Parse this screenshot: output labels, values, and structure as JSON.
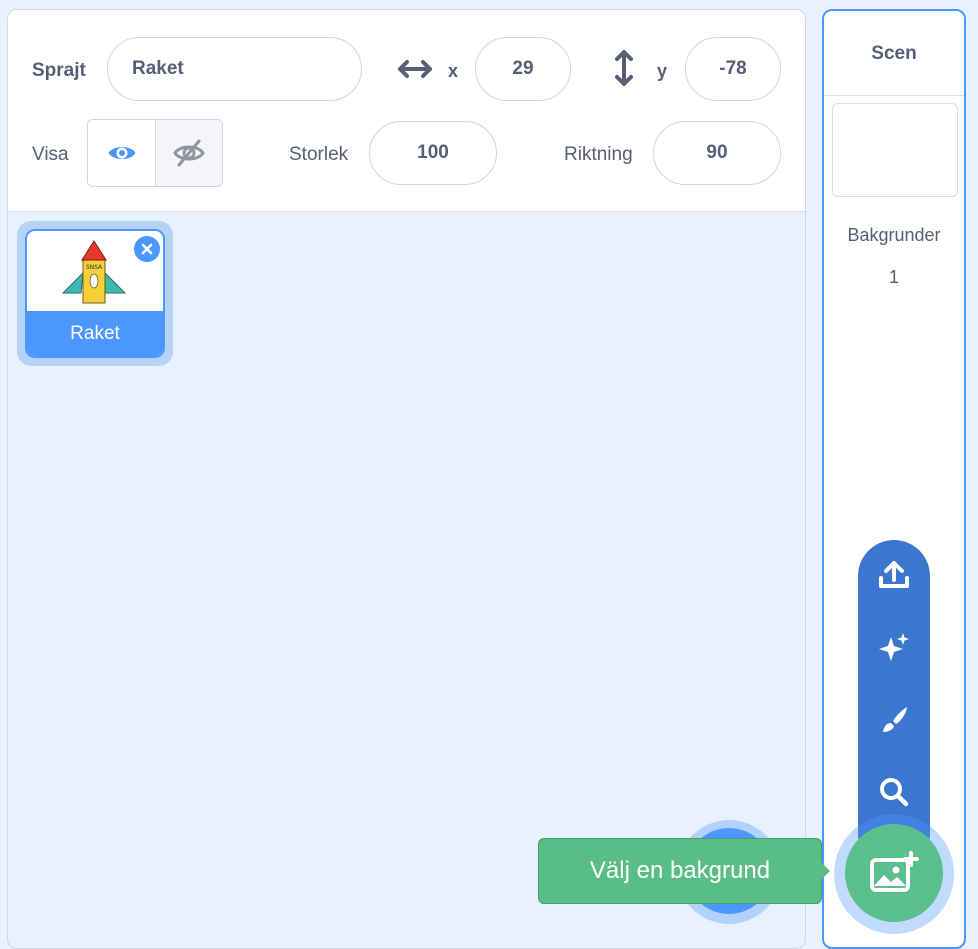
{
  "sprite_info": {
    "sprite_label": "Sprajt",
    "sprite_name": "Raket",
    "x_label": "x",
    "x_value": "29",
    "y_label": "y",
    "y_value": "-78",
    "show_label": "Visa",
    "size_label": "Storlek",
    "size_value": "100",
    "direction_label": "Riktning",
    "direction_value": "90"
  },
  "sprites": [
    {
      "name": "Raket",
      "costume_text": "SNSA"
    }
  ],
  "stage": {
    "title": "Scen",
    "backdrops_label": "Bakgrunder",
    "backdrops_count": "1"
  },
  "tooltip": {
    "text": "Välj en bakgrund"
  },
  "colors": {
    "accent": "#4c97ff",
    "menu": "#3d76cf",
    "green": "#59c08d"
  }
}
